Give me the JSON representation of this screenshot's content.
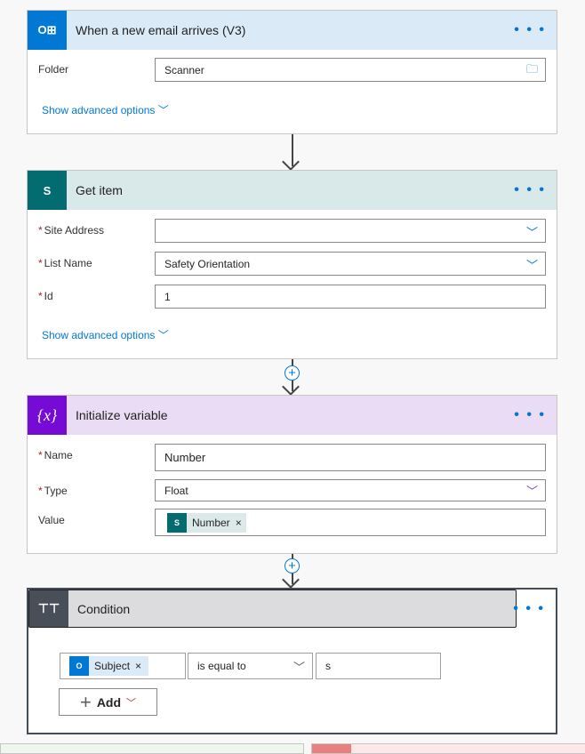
{
  "trigger": {
    "title": "When a new email arrives (V3)",
    "folder_label": "Folder",
    "folder_value": "Scanner",
    "advanced": "Show advanced options",
    "color": "#0078d4"
  },
  "get_item": {
    "title": "Get item",
    "site_label": "Site Address",
    "site_value": "",
    "list_label": "List Name",
    "list_value": "Safety Orientation",
    "id_label": "Id",
    "id_value": "1",
    "advanced": "Show advanced options",
    "color": "#036c70"
  },
  "init_var": {
    "title": "Initialize variable",
    "icon_text": "{x}",
    "name_label": "Name",
    "name_value": "Number",
    "type_label": "Type",
    "type_value": "Float",
    "value_label": "Value",
    "value_token": "Number",
    "color": "#770bd6"
  },
  "condition": {
    "title": "Condition",
    "left_token": "Subject",
    "operator": "is equal to",
    "right_value": "s",
    "add_label": "Add",
    "color": "#484f58"
  },
  "menu": "• • •"
}
